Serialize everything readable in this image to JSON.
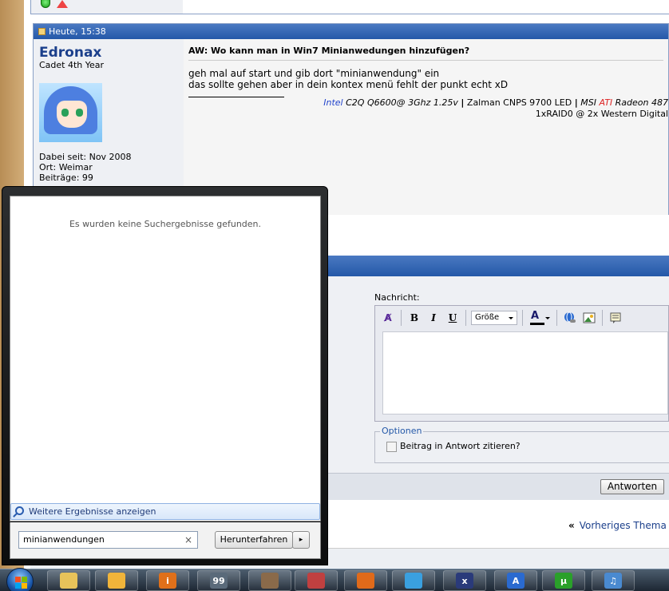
{
  "post": {
    "date": "Heute, 15:38",
    "username": "Edronax",
    "usertitle": "Cadet 4th Year",
    "joined": "Dabei seit: Nov 2008",
    "location": "Ort: Weimar",
    "posts": "Beiträge: 99",
    "title": "AW: Wo kann man in Win7 Minianwedungen hinzufügen?",
    "body_line1": "geh mal auf start und gib dort \"minianwendung\" ein",
    "body_line2": "das sollte gehen aber in dein kontex menü fehlt der punkt echt xD",
    "sig": {
      "intel": "Intel",
      "cpu": " C2Q Q6600@ 3Ghz 1.25v ",
      "sep1": "|",
      "cooler": " Zalman CNPS 9700 LED ",
      "sep2": "|",
      "msi": " MSI ",
      "ati": "ATI",
      "gpu": " Radeon 487",
      "line2": "1xRAID0 @ 2x Western Digital"
    }
  },
  "quick_reply": {
    "message_label": "Nachricht:",
    "size_select": "Größe",
    "options_legend": "Optionen",
    "quote_label": "Beitrag in Antwort zitieren?",
    "reply_button": "Antworten",
    "prev_topic_marker": "«",
    "prev_topic": "Vorheriges Thema"
  },
  "start_menu": {
    "no_results": "Es wurden keine Suchergebnisse gefunden.",
    "more_results": "Weitere Ergebnisse anzeigen",
    "search_value": "minianwendungen",
    "clear_symbol": "×",
    "shutdown": "Herunterfahren",
    "shutdown_arrow": "▸"
  },
  "taskbar": {
    "items": [
      {
        "name": "explorer",
        "label": "",
        "color": "#e8c35a"
      },
      {
        "name": "outlook",
        "label": "",
        "color": "#f0b43a"
      },
      {
        "name": "info",
        "label": "i",
        "color": "#e0701a"
      },
      {
        "name": "monitor",
        "label": "99",
        "color": "#5a6a7a"
      },
      {
        "name": "camera",
        "label": "",
        "color": "#8a6a4a"
      },
      {
        "name": "paint",
        "label": "",
        "color": "#c04040"
      },
      {
        "name": "firefox",
        "label": "",
        "color": "#e06a1a"
      },
      {
        "name": "messenger",
        "label": "",
        "color": "#3aa0e0"
      },
      {
        "name": "x-app",
        "label": "x",
        "color": "#2a3a7a"
      },
      {
        "name": "arrow-app",
        "label": "A",
        "color": "#2a6ad0"
      },
      {
        "name": "utorrent",
        "label": "µ",
        "color": "#2aa02a"
      },
      {
        "name": "itunes",
        "label": "♫",
        "color": "#4a8ad0"
      }
    ]
  }
}
